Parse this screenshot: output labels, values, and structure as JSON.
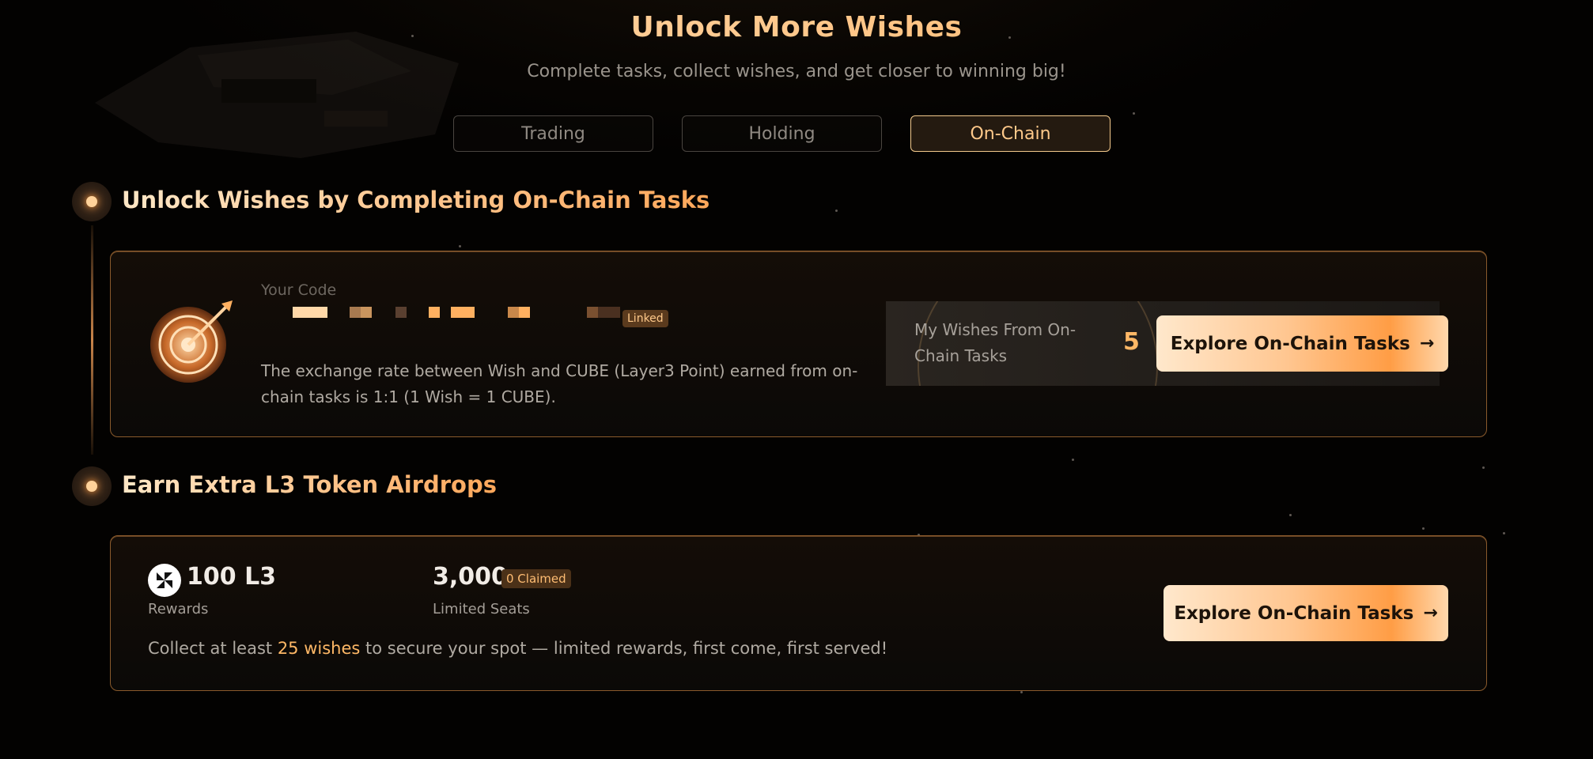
{
  "hero": {
    "title": "Unlock More Wishes",
    "subtitle": "Complete tasks, collect wishes, and get closer to winning big!"
  },
  "tabs": [
    {
      "label": "Trading",
      "active": false
    },
    {
      "label": "Holding",
      "active": false
    },
    {
      "label": "On-Chain",
      "active": true
    }
  ],
  "section1": {
    "title": "Unlock Wishes by Completing On-Chain Tasks",
    "code_label": "Your Code",
    "linked_badge": "Linked",
    "rate_text": "The exchange rate between Wish and CUBE (Layer3 Point) earned from on-chain tasks is 1:1 (1 Wish = 1 CUBE).",
    "wish_label": "My Wishes From On-Chain Tasks",
    "wish_value": "5",
    "cta_label": "Explore On-Chain Tasks"
  },
  "section2": {
    "title": "Earn Extra L3 Token Airdrops",
    "reward_value": "100 L3",
    "reward_label": "Rewards",
    "seats_value": "3,000",
    "claimed_badge": "0 Claimed",
    "seats_label": "Limited Seats",
    "collect_prefix": "Collect at least ",
    "collect_highlight": "25 wishes",
    "collect_suffix": " to secure your spot — limited rewards, first come, first served!",
    "cta_label": "Explore On-Chain Tasks"
  },
  "colors": {
    "accent": "#ffb866",
    "background": "#030201",
    "card_border": "#8a5a2c"
  },
  "icons": {
    "target": "target-icon",
    "arrow": "arrow-right-icon",
    "l3": "l3-token-icon"
  }
}
